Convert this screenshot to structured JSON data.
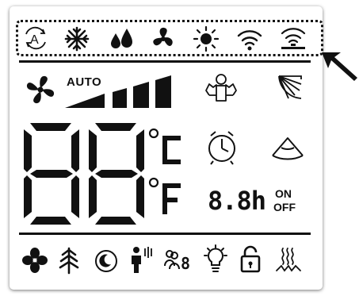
{
  "display": {
    "fan_mode_label": "AUTO",
    "temperature_digits": "88",
    "unit_celsius": "°C",
    "unit_fahrenheit": "°F",
    "timer_value": "8.8h",
    "timer_on": "ON",
    "timer_off": "OFF",
    "segment_color": "#111111"
  },
  "icons": {
    "mode_row": [
      "auto-mode-icon",
      "snowflake-icon",
      "dry-mode-icon",
      "fan-mode-icon",
      "heat-sun-icon",
      "wifi-icon",
      "wifi-signal-icon"
    ],
    "bottom_row": [
      "fan-icon",
      "tree-eco-icon",
      "sleep-icon",
      "person-sensing-icon",
      "people-counter-icon",
      "light-bulb-icon",
      "lock-icon",
      "heater-icon"
    ]
  }
}
